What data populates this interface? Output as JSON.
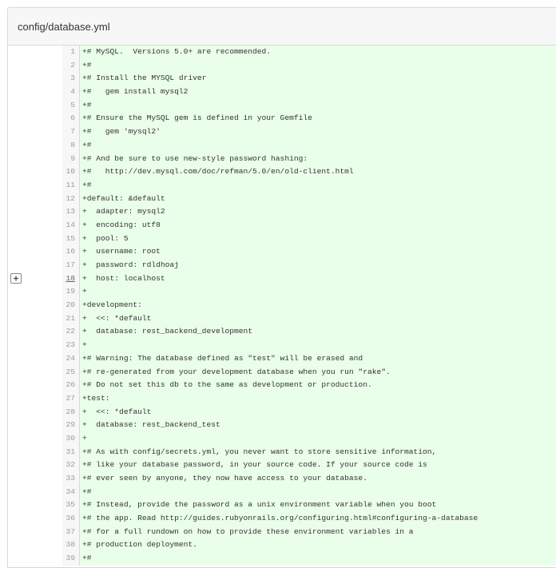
{
  "file": {
    "path": "config/database.yml"
  },
  "colors": {
    "added_line_bg": "#eaffea",
    "gutter_bg": "#f7f7f7",
    "line_number": "#9a9a9a"
  },
  "lines": [
    {
      "num": "1",
      "text": "+# MySQL.  Versions 5.0+ are recommended."
    },
    {
      "num": "2",
      "text": "+#"
    },
    {
      "num": "3",
      "text": "+# Install the MYSQL driver"
    },
    {
      "num": "4",
      "text": "+#   gem install mysql2"
    },
    {
      "num": "5",
      "text": "+#"
    },
    {
      "num": "6",
      "text": "+# Ensure the MySQL gem is defined in your Gemfile"
    },
    {
      "num": "7",
      "text": "+#   gem 'mysql2'"
    },
    {
      "num": "8",
      "text": "+#"
    },
    {
      "num": "9",
      "text": "+# And be sure to use new-style password hashing:"
    },
    {
      "num": "10",
      "text": "+#   http://dev.mysql.com/doc/refman/5.0/en/old-client.html"
    },
    {
      "num": "11",
      "text": "+#"
    },
    {
      "num": "12",
      "text": "+default: &default"
    },
    {
      "num": "13",
      "text": "+  adapter: mysql2"
    },
    {
      "num": "14",
      "text": "+  encoding: utf8"
    },
    {
      "num": "15",
      "text": "+  pool: 5"
    },
    {
      "num": "16",
      "text": "+  username: root"
    },
    {
      "num": "17",
      "text": "+  password: rdldhoaj"
    },
    {
      "num": "18",
      "text": "+  host: localhost"
    },
    {
      "num": "19",
      "text": "+"
    },
    {
      "num": "20",
      "text": "+development:"
    },
    {
      "num": "21",
      "text": "+  <<: *default"
    },
    {
      "num": "22",
      "text": "+  database: rest_backend_development"
    },
    {
      "num": "23",
      "text": "+"
    },
    {
      "num": "24",
      "text": "+# Warning: The database defined as \"test\" will be erased and"
    },
    {
      "num": "25",
      "text": "+# re-generated from your development database when you run \"rake\"."
    },
    {
      "num": "26",
      "text": "+# Do not set this db to the same as development or production."
    },
    {
      "num": "27",
      "text": "+test:"
    },
    {
      "num": "28",
      "text": "+  <<: *default"
    },
    {
      "num": "29",
      "text": "+  database: rest_backend_test"
    },
    {
      "num": "30",
      "text": "+"
    },
    {
      "num": "31",
      "text": "+# As with config/secrets.yml, you never want to store sensitive information,"
    },
    {
      "num": "32",
      "text": "+# like your database password, in your source code. If your source code is"
    },
    {
      "num": "33",
      "text": "+# ever seen by anyone, they now have access to your database."
    },
    {
      "num": "34",
      "text": "+#"
    },
    {
      "num": "35",
      "text": "+# Instead, provide the password as a unix environment variable when you boot"
    },
    {
      "num": "36",
      "text": "+# the app. Read http://guides.rubyonrails.org/configuring.html#configuring-a-database"
    },
    {
      "num": "37",
      "text": "+# for a full rundown on how to provide these environment variables in a"
    },
    {
      "num": "38",
      "text": "+# production deployment."
    },
    {
      "num": "39",
      "text": "+#"
    }
  ],
  "hovered_line": "18",
  "add_comment_icon": "plus-comment-icon"
}
